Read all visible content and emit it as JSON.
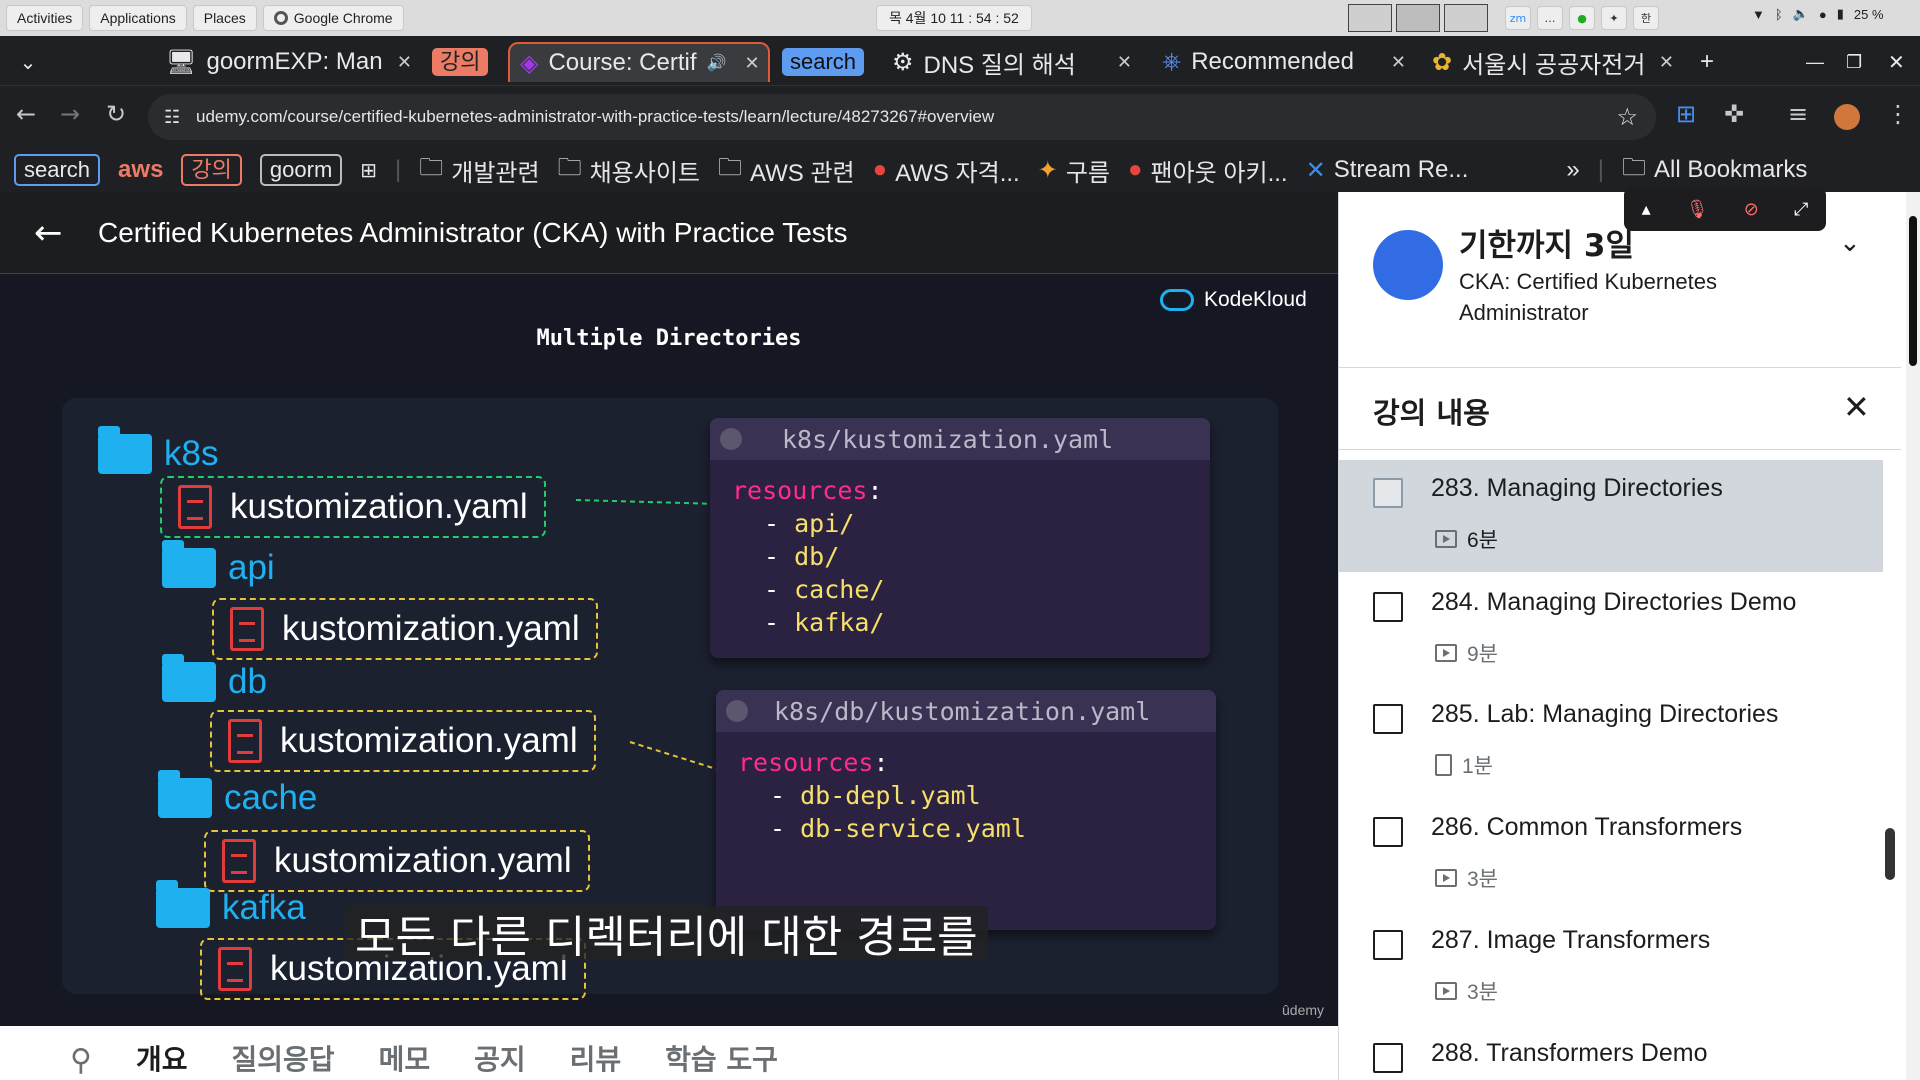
{
  "system": {
    "activities": "Activities",
    "applications": "Applications",
    "places": "Places",
    "chrome": "Google Chrome",
    "clock": "목 4월 10  11 : 54 : 52",
    "ime": "한",
    "battery": "25 %"
  },
  "tabs": [
    {
      "label": "goormEXP: Man"
    },
    {
      "label": "강의"
    },
    {
      "label": "Course: Certif"
    },
    {
      "label": "search"
    },
    {
      "label": "DNS 질의 해석"
    },
    {
      "label": "Recommended"
    },
    {
      "label": "서울시 공공자전거"
    }
  ],
  "address": {
    "url": "udemy.com/course/certified-kubernetes-administrator-with-practice-tests/learn/lecture/48273267#overview"
  },
  "bookmarks": {
    "search": "search",
    "aws": "aws",
    "gangui": "강의",
    "goorm": "goorm",
    "items": [
      "개발관련",
      "채용사이트",
      "AWS 관련",
      "AWS 자격...",
      "구름",
      "팬아웃 아키...",
      "Stream Re..."
    ],
    "more": "»",
    "all": "All Bookmarks"
  },
  "course": {
    "title": "Certified Kubernetes Administrator (CKA) with Practice Tests"
  },
  "slide": {
    "brand": "KodeKloud",
    "title": "Multiple Directories",
    "folders": {
      "k8s": "k8s",
      "api": "api",
      "db": "db",
      "cache": "cache",
      "kafka": "kafka"
    },
    "file": "kustomization.yaml",
    "panel1": {
      "header": "k8s/kustomization.yaml",
      "key": "resources",
      "colon": ":",
      "items": [
        "api/",
        "db/",
        "cache/",
        "kafka/"
      ]
    },
    "panel2": {
      "header": "k8s/db/kustomization.yaml",
      "key": "resources",
      "colon": ":",
      "items": [
        "db-depl.yaml",
        "db-service.yaml"
      ]
    },
    "subtitle": "모든 다른 디렉터리에 대한 경로를",
    "watermark": "ûdemy"
  },
  "bottom_tabs": [
    "개요",
    "질의응답",
    "메모",
    "공지",
    "리뷰",
    "학습 도구"
  ],
  "sidebar": {
    "promo_title": "기한까지 3일",
    "promo_sub": "CKA: Certified Kubernetes Administrator",
    "content_title": "강의 내용",
    "items": [
      {
        "title": "283. Managing Directories",
        "meta": "6분"
      },
      {
        "title": "284. Managing Directories Demo",
        "meta": "9분"
      },
      {
        "title": "285. Lab: Managing Directories",
        "meta": "1분"
      },
      {
        "title": "286. Common Transformers",
        "meta": "3분"
      },
      {
        "title": "287. Image Transformers",
        "meta": "3분"
      },
      {
        "title": "288. Transformers Demo",
        "meta": ""
      }
    ]
  },
  "colors": {
    "accent": "#1fb0f0",
    "yaml_key": "#ff2c8a",
    "yaml_val": "#f7e06a",
    "active_tab": "#e05a3a"
  }
}
